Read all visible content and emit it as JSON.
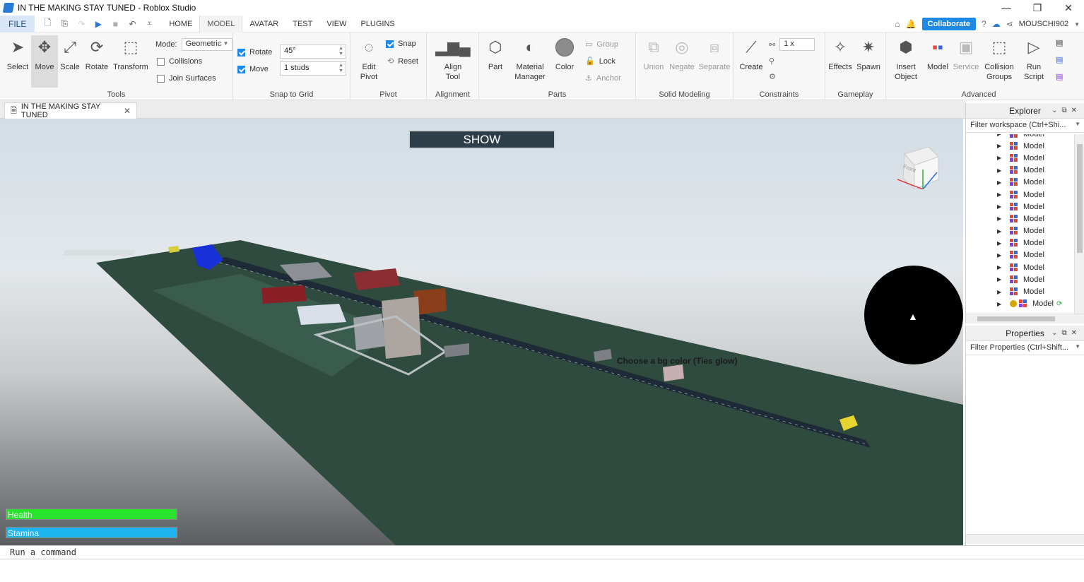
{
  "window": {
    "title": "IN THE MAKING STAY TUNED - Roblox Studio",
    "controls": [
      "—",
      "❐",
      "✕"
    ]
  },
  "menu": {
    "file": "FILE",
    "tabs": [
      "HOME",
      "MODEL",
      "AVATAR",
      "TEST",
      "VIEW",
      "PLUGINS"
    ],
    "active_tab": "MODEL",
    "collaborate": "Collaborate",
    "user": "MOUSCHI902"
  },
  "ribbon": {
    "tools": {
      "label": "Tools",
      "select": "Select",
      "move": "Move",
      "scale": "Scale",
      "rotate": "Rotate",
      "transform": "Transform",
      "mode_label": "Mode:",
      "mode_value": "Geometric",
      "collisions": "Collisions",
      "join_surfaces": "Join Surfaces"
    },
    "snap": {
      "label": "Snap to Grid",
      "rotate": "Rotate",
      "rotate_value": "45°",
      "move": "Move",
      "move_value": "1 studs"
    },
    "pivot": {
      "label": "Pivot",
      "edit_pivot": "Edit Pivot",
      "snap": "Snap",
      "reset": "Reset"
    },
    "alignment": {
      "label": "Alignment",
      "align_tool": "Align Tool"
    },
    "parts": {
      "label": "Parts",
      "part": "Part",
      "material_manager": "Material Manager",
      "color": "Color",
      "group": "Group",
      "lock": "Lock",
      "anchor": "Anchor"
    },
    "solid": {
      "label": "Solid Modeling",
      "union": "Union",
      "negate": "Negate",
      "separate": "Separate"
    },
    "constraints": {
      "label": "Constraints",
      "create": "Create",
      "scale_value": "1 x"
    },
    "gameplay": {
      "label": "Gameplay",
      "effects": "Effects",
      "spawn": "Spawn"
    },
    "advanced": {
      "label": "Advanced",
      "insert_object": "Insert Object",
      "model": "Model",
      "service": "Service",
      "collision_groups": "Collision Groups",
      "run_script": "Run Script"
    }
  },
  "document_tab": "IN THE MAKING STAY TUNED",
  "viewport": {
    "show_button": "SHOW",
    "hint": "Choose a bg color (Ties glow)",
    "health": "Health",
    "health_level": 1.0,
    "stamina": "Stamina",
    "stamina_level": 1.0,
    "viewcube_face": "Front"
  },
  "explorer": {
    "title": "Explorer",
    "filter": "Filter workspace (Ctrl+Shi...",
    "items": [
      "Model",
      "Model",
      "Model",
      "Model",
      "Model",
      "Model",
      "Model",
      "Model",
      "Model",
      "Model",
      "Model",
      "Model",
      "Model",
      "Model",
      "Model"
    ]
  },
  "properties": {
    "title": "Properties",
    "filter": "Filter Properties (Ctrl+Shift..."
  },
  "command_bar": {
    "placeholder": "Run a command"
  },
  "colors": {
    "accent": "#1e88e5",
    "health": "#27e32c",
    "stamina": "#1eb4f0",
    "baseplate": "#2f4a3e"
  }
}
